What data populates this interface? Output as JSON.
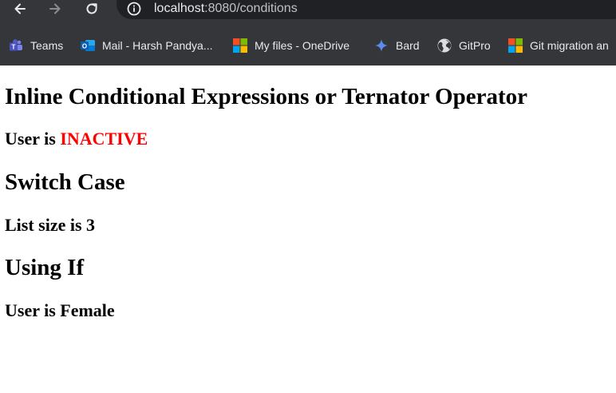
{
  "browser": {
    "url_host": "localhost",
    "url_rest": ":8080/conditions",
    "bookmarks": [
      {
        "label": "Teams",
        "icon": "teams-icon"
      },
      {
        "label": "Mail - Harsh Pandya...",
        "icon": "outlook-icon"
      },
      {
        "label": "My files - OneDrive",
        "icon": "microsoft-icon"
      },
      {
        "label": "Bard",
        "icon": "bard-sparkle-icon"
      },
      {
        "label": "GitPro",
        "icon": "globe-icon"
      },
      {
        "label": "Git migration an",
        "icon": "microsoft-icon"
      }
    ]
  },
  "page": {
    "section1_heading": "Inline Conditional Expressions or Ternator Operator",
    "user_status_prefix": "User is ",
    "user_status_value": "INACTIVE",
    "section2_heading": "Switch Case",
    "list_size_text": "List size is 3",
    "section3_heading": "Using If",
    "gender_text": "User is Female"
  },
  "colors": {
    "chrome_bg": "#35363a",
    "omnibox_bg": "#202124",
    "inactive": "#ff0000"
  }
}
